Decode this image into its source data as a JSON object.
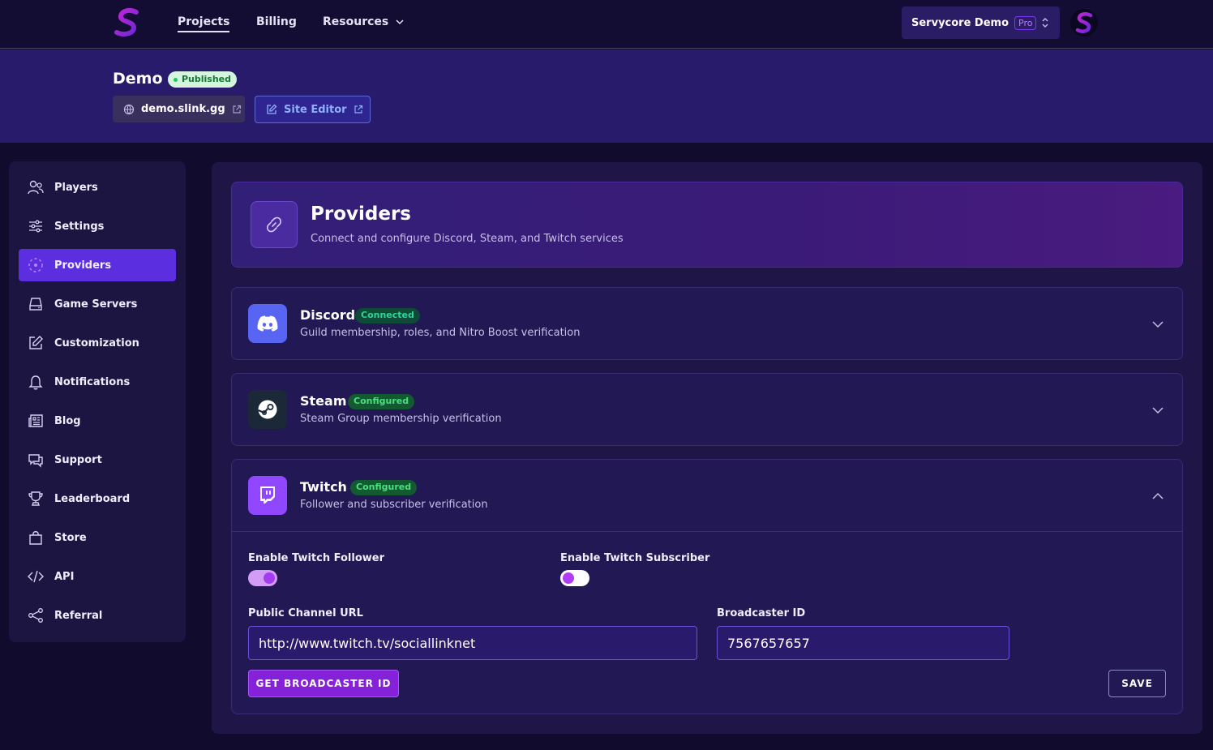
{
  "nav": {
    "projects": "Projects",
    "billing": "Billing",
    "resources": "Resources",
    "org_name": "Servycore Demo",
    "org_plan": "Pro"
  },
  "project": {
    "title": "Demo",
    "status": "Published",
    "domain": "demo.slink.gg",
    "site_editor": "Site Editor"
  },
  "sidebar": {
    "items": [
      {
        "label": "Players",
        "icon": "users-icon"
      },
      {
        "label": "Settings",
        "icon": "sliders-icon"
      },
      {
        "label": "Providers",
        "icon": "providers-icon",
        "active": true
      },
      {
        "label": "Game Servers",
        "icon": "server-icon"
      },
      {
        "label": "Customization",
        "icon": "edit-icon"
      },
      {
        "label": "Notifications",
        "icon": "bell-icon"
      },
      {
        "label": "Blog",
        "icon": "newspaper-icon"
      },
      {
        "label": "Support",
        "icon": "chat-icon"
      },
      {
        "label": "Leaderboard",
        "icon": "trophy-icon"
      },
      {
        "label": "Store",
        "icon": "bag-icon"
      },
      {
        "label": "API",
        "icon": "code-icon"
      },
      {
        "label": "Referral",
        "icon": "share-icon"
      }
    ]
  },
  "hero": {
    "title": "Providers",
    "subtitle": "Connect and configure Discord, Steam, and Twitch services"
  },
  "providers": [
    {
      "name": "Discord",
      "status": "Connected",
      "description": "Guild membership, roles, and Nitro Boost verification",
      "expanded": false
    },
    {
      "name": "Steam",
      "status": "Configured",
      "description": "Steam Group membership verification",
      "expanded": false
    },
    {
      "name": "Twitch",
      "status": "Configured",
      "description": "Follower and subscriber verification",
      "expanded": true
    }
  ],
  "twitch_form": {
    "follower_label": "Enable Twitch Follower",
    "follower_enabled": true,
    "subscriber_label": "Enable Twitch Subscriber",
    "subscriber_enabled": false,
    "channel_url_label": "Public Channel URL",
    "channel_url_value": "http://www.twitch.tv/sociallinknet",
    "broadcaster_id_label": "Broadcaster ID",
    "broadcaster_id_value": "7567657657",
    "get_broadcaster_button": "GET BROADCASTER ID",
    "save_button": "SAVE"
  },
  "colors": {
    "accent": "#5b2ee0",
    "background": "#110b2e",
    "discord": "#5865f2",
    "twitch": "#9146ff",
    "steam": "#1b2838",
    "success": "#4ade80"
  }
}
